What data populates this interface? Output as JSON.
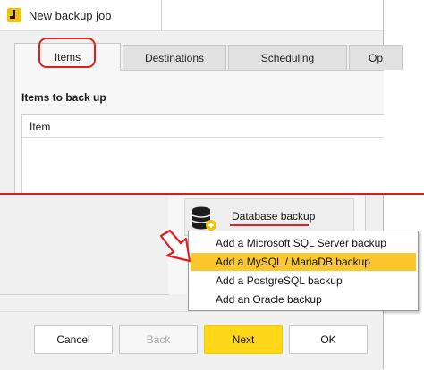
{
  "window": {
    "title": "New backup job"
  },
  "tabs": [
    {
      "label": "Items",
      "active": true
    },
    {
      "label": "Destinations",
      "active": false
    },
    {
      "label": "Scheduling",
      "active": false
    },
    {
      "label": "Op",
      "active": false
    }
  ],
  "items_section": {
    "heading": "Items to back up",
    "column_header": "Item"
  },
  "database_backup": {
    "label": "Database backup",
    "icon": "database-add-icon"
  },
  "context_menu": {
    "items": [
      {
        "label": "Add a Microsoft SQL Server backup",
        "highlighted": false
      },
      {
        "label": "Add a MySQL / MariaDB backup",
        "highlighted": true
      },
      {
        "label": "Add a PostgreSQL backup",
        "highlighted": false
      },
      {
        "label": "Add an Oracle backup",
        "highlighted": false
      }
    ]
  },
  "footer": {
    "cancel": "Cancel",
    "back": "Back",
    "next": "Next",
    "ok": "OK"
  },
  "colors": {
    "accent_yellow": "#ffd71a",
    "menu_highlight": "#fac72e",
    "annotation_red": "#e02020"
  }
}
